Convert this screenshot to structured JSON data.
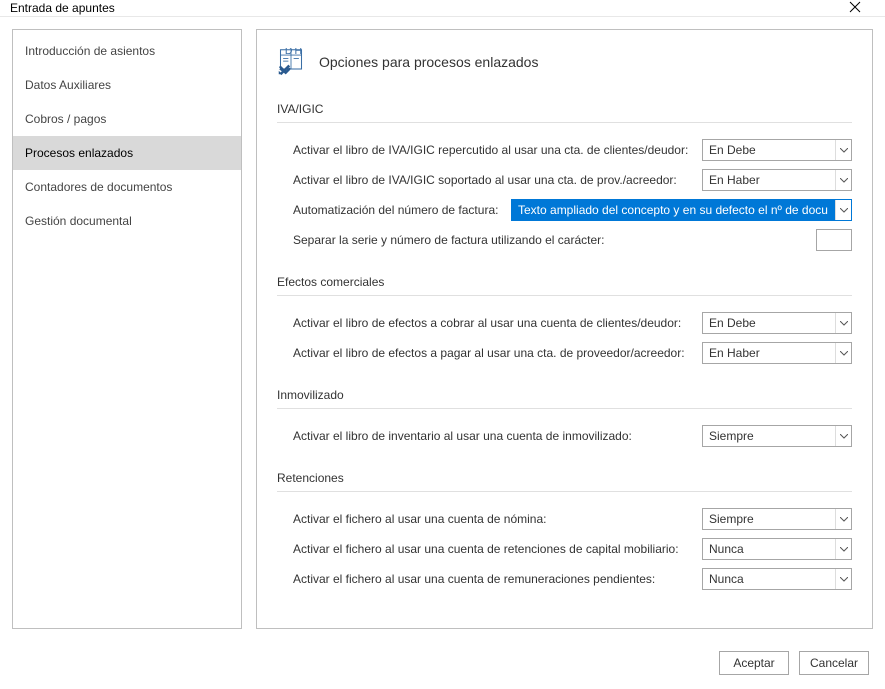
{
  "window": {
    "title": "Entrada de apuntes"
  },
  "sidebar": {
    "items": [
      {
        "label": "Introducción de asientos"
      },
      {
        "label": "Datos Auxiliares"
      },
      {
        "label": "Cobros / pagos"
      },
      {
        "label": "Procesos enlazados"
      },
      {
        "label": "Contadores de documentos"
      },
      {
        "label": "Gestión documental"
      }
    ]
  },
  "panel": {
    "title": "Opciones para procesos enlazados",
    "sections": {
      "iva": {
        "title": "IVA/IGIC",
        "rows": {
          "repercutido": {
            "label": "Activar el libro de IVA/IGIC repercutido al usar una cta. de clientes/deudor:",
            "value": "En Debe"
          },
          "soportado": {
            "label": "Activar el libro de IVA/IGIC soportado al usar una cta. de prov./acreedor:",
            "value": "En Haber"
          },
          "auto_num": {
            "label": "Automatización del número de factura:",
            "value": "Texto ampliado del concepto y en su defecto el nº de docu"
          },
          "separar": {
            "label": "Separar la serie y número de factura utilizando el carácter:",
            "value": ""
          }
        }
      },
      "efectos": {
        "title": "Efectos comerciales",
        "rows": {
          "cobrar": {
            "label": "Activar el libro de efectos a cobrar al usar una cuenta de clientes/deudor:",
            "value": "En Debe"
          },
          "pagar": {
            "label": "Activar el libro de efectos a pagar al usar una cta. de proveedor/acreedor:",
            "value": "En Haber"
          }
        }
      },
      "inmovilizado": {
        "title": "Inmovilizado",
        "rows": {
          "inventario": {
            "label": "Activar el libro de inventario al usar una cuenta de inmovilizado:",
            "value": "Siempre"
          }
        }
      },
      "retenciones": {
        "title": "Retenciones",
        "rows": {
          "nomina": {
            "label": "Activar el fichero al usar una cuenta de nómina:",
            "value": "Siempre"
          },
          "capital": {
            "label": "Activar el fichero al usar una cuenta de retenciones de capital mobiliario:",
            "value": "Nunca"
          },
          "remuneraciones": {
            "label": "Activar el fichero al usar una cuenta de remuneraciones pendientes:",
            "value": "Nunca"
          }
        }
      }
    }
  },
  "buttons": {
    "accept": "Aceptar",
    "cancel": "Cancelar"
  }
}
